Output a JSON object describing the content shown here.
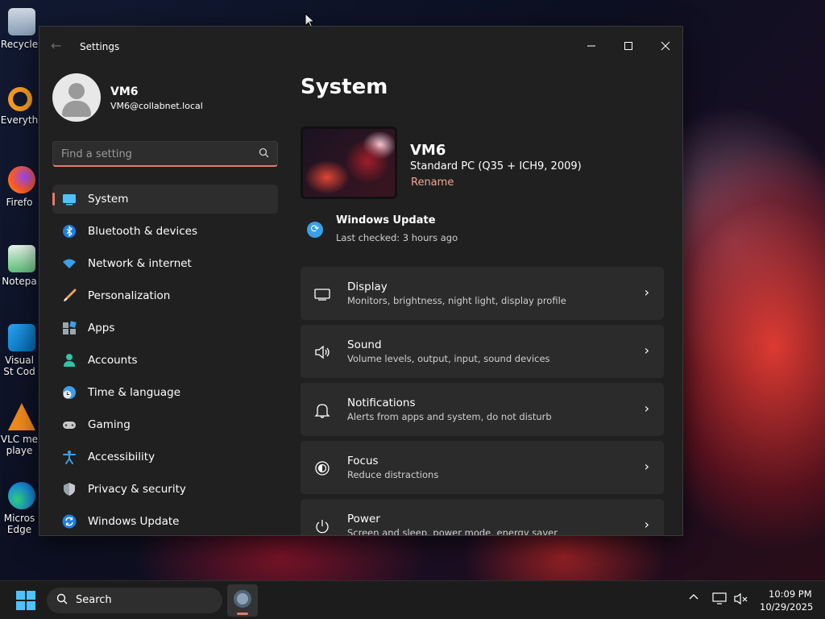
{
  "desktop": {
    "icons": [
      {
        "label": "Recycle"
      },
      {
        "label": "Everyth"
      },
      {
        "label": "Firefo"
      },
      {
        "label": "Notepa"
      },
      {
        "label": "Visual St Cod"
      },
      {
        "label": "VLC me playe"
      },
      {
        "label": "Micros Edge"
      }
    ]
  },
  "window": {
    "title": "Settings",
    "controls": {
      "minimize": "—",
      "maximize": "☐",
      "close": "✕"
    }
  },
  "profile": {
    "name": "VM6",
    "email": "VM6@collabnet.local"
  },
  "search": {
    "placeholder": "Find a setting"
  },
  "nav": {
    "items": [
      {
        "label": "System",
        "icon": "system-icon",
        "active": true
      },
      {
        "label": "Bluetooth & devices",
        "icon": "bluetooth-icon"
      },
      {
        "label": "Network & internet",
        "icon": "network-icon"
      },
      {
        "label": "Personalization",
        "icon": "brush-icon"
      },
      {
        "label": "Apps",
        "icon": "apps-icon"
      },
      {
        "label": "Accounts",
        "icon": "accounts-icon"
      },
      {
        "label": "Time & language",
        "icon": "clock-globe-icon"
      },
      {
        "label": "Gaming",
        "icon": "gamepad-icon"
      },
      {
        "label": "Accessibility",
        "icon": "accessibility-icon"
      },
      {
        "label": "Privacy & security",
        "icon": "shield-icon"
      },
      {
        "label": "Windows Update",
        "icon": "update-icon"
      }
    ]
  },
  "main": {
    "title": "System",
    "device": {
      "name": "VM6",
      "model": "Standard PC (Q35 + ICH9, 2009)",
      "rename": "Rename"
    },
    "update": {
      "title": "Windows Update",
      "subtitle": "Last checked: 3 hours ago"
    },
    "cards": [
      {
        "title": "Display",
        "subtitle": "Monitors, brightness, night light, display profile",
        "icon": "monitor-icon"
      },
      {
        "title": "Sound",
        "subtitle": "Volume levels, output, input, sound devices",
        "icon": "speaker-icon"
      },
      {
        "title": "Notifications",
        "subtitle": "Alerts from apps and system, do not disturb",
        "icon": "bell-icon"
      },
      {
        "title": "Focus",
        "subtitle": "Reduce distractions",
        "icon": "focus-icon"
      },
      {
        "title": "Power",
        "subtitle": "Screen and sleep, power mode, energy saver",
        "icon": "power-icon"
      }
    ]
  },
  "taskbar": {
    "search_label": "Search",
    "time": "10:09 PM",
    "date": "10/29/2025"
  },
  "colors": {
    "accent": "#e47b6c",
    "window_bg": "#202020",
    "card_bg": "#2b2b2b",
    "update_blue": "#3aa0e8"
  }
}
